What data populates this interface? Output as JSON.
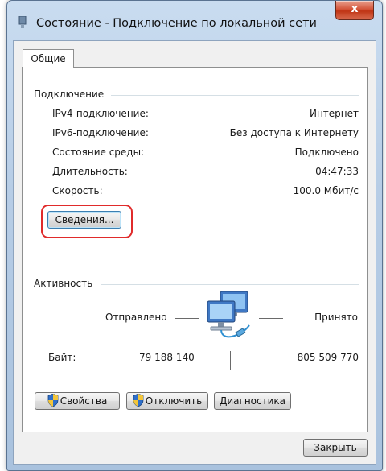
{
  "window": {
    "title": "Состояние - Подключение по локальной сети",
    "close_glyph": "x"
  },
  "tabs": [
    {
      "label": "Общие",
      "selected": true
    }
  ],
  "connection": {
    "header": "Подключение",
    "rows": [
      {
        "label": "IPv4-подключение:",
        "value": "Интернет"
      },
      {
        "label": "IPv6-подключение:",
        "value": "Без доступа к Интернету"
      },
      {
        "label": "Состояние среды:",
        "value": "Подключено"
      },
      {
        "label": "Длительность:",
        "value": "04:47:33"
      },
      {
        "label": "Скорость:",
        "value": "100.0 Мбит/с"
      }
    ],
    "details_button": "Сведения..."
  },
  "activity": {
    "header": "Активность",
    "sent_label": "Отправлено",
    "received_label": "Принято",
    "bytes_label": "Байт:",
    "bytes_sent": "79 188 140",
    "bytes_received": "805 509 770"
  },
  "buttons": {
    "properties": "Свойства",
    "disable": "Отключить",
    "diagnose": "Диагностика",
    "close": "Закрыть"
  },
  "colors": {
    "highlight": "#e02b2b",
    "shield_blue": "#2f6fc9",
    "shield_yellow": "#f3c53a"
  }
}
